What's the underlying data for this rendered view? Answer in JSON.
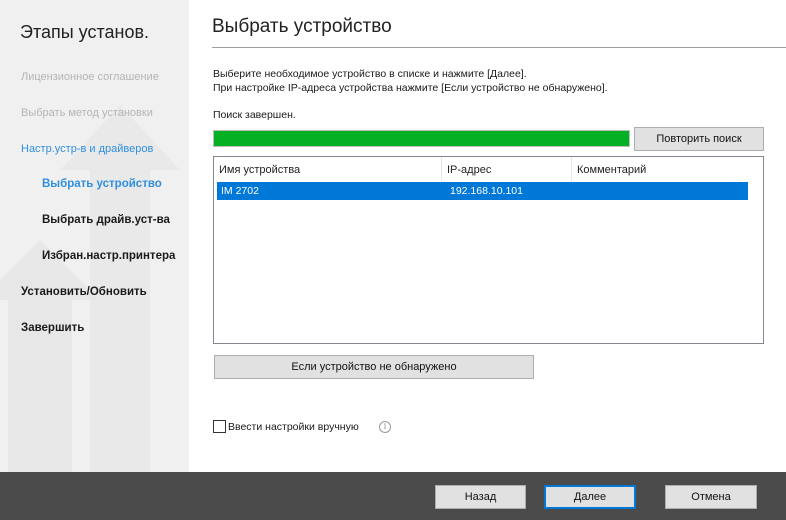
{
  "sidebar": {
    "title": "Этапы установ.",
    "steps": [
      {
        "label": "Лицензионное соглашение",
        "state": "done"
      },
      {
        "label": "Выбрать метод установки",
        "state": "done"
      },
      {
        "label": "Настр.устр-в и драйверов",
        "state": "active-parent"
      },
      {
        "label": "Выбрать устройство",
        "state": "current"
      },
      {
        "label": "Выбрать драйв.уст-ва",
        "state": "todo"
      },
      {
        "label": "Избран.настр.принтера",
        "state": "todo"
      },
      {
        "label": "Установить/Обновить",
        "state": "todo"
      },
      {
        "label": "Завершить",
        "state": "todo"
      }
    ]
  },
  "main": {
    "title": "Выбрать устройство",
    "instruction_line1": "Выберите необходимое устройство в списке и нажмите [Далее].",
    "instruction_line2": "При настройке IP-адреса устройства нажмите [Если устройство не обнаружено].",
    "status": "Поиск завершен.",
    "progress": 1.0,
    "retry_button": "Повторить поиск",
    "table": {
      "columns": [
        "Имя устройства",
        "IP-адрес",
        "Комментарий"
      ],
      "rows": [
        {
          "name": "IM 2702",
          "ip": "192.168.10.101",
          "comment": "",
          "selected": true
        }
      ]
    },
    "not_found_button": "Если устройство не обнаружено",
    "manual_checkbox": {
      "label": "Ввести настройки вручную",
      "checked": false
    },
    "info_icon_glyph": "i"
  },
  "footer": {
    "back": "Назад",
    "next": "Далее",
    "cancel": "Отмена"
  },
  "colors": {
    "accent": "#0078d7",
    "step_active": "#2f8fdf",
    "progress": "#06b025",
    "footer": "#4b4b4b",
    "sidebar": "#f0f0f0"
  }
}
